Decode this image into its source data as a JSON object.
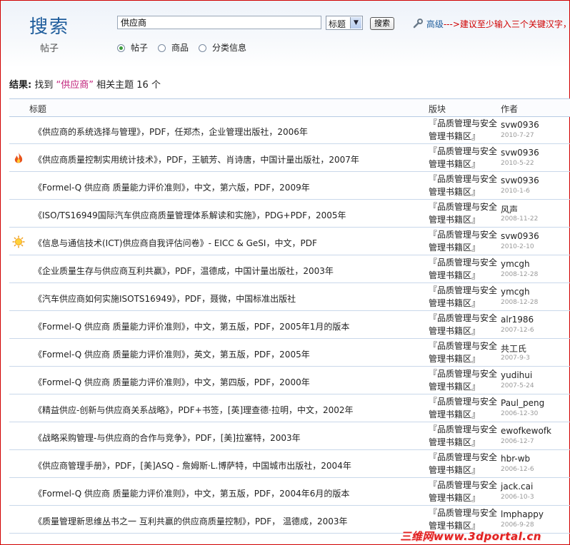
{
  "header": {
    "brand": "搜索",
    "brand_sub": "帖子",
    "search_value": "供应商",
    "select_value": "标题",
    "search_button": "搜索",
    "advanced_link": "高级",
    "advanced_hint": "--->建议至少输入三个关键汉字，",
    "radios": [
      {
        "label": "帖子",
        "checked": true
      },
      {
        "label": "商品",
        "checked": false
      },
      {
        "label": "分类信息",
        "checked": false
      }
    ]
  },
  "results": {
    "label": "结果:",
    "found": "找到",
    "keyword": "“供应商”",
    "related": "相关主题",
    "count": "16 个"
  },
  "table": {
    "columns": {
      "title": "标题",
      "forum": "版块",
      "author": "作者"
    },
    "rows": [
      {
        "icon": "",
        "title": "《供应商的系统选择与管理》，PDF，任郑杰，企业管理出版社，2006年",
        "forum": "『品质管理与安全管理书籍区』",
        "author": "svw0936",
        "date": "2010-7-27"
      },
      {
        "icon": "fire-icon",
        "title": "《供应商质量控制实用统计技术》，PDF，王毓芳、肖诗唐，中国计量出版社，2007年",
        "forum": "『品质管理与安全管理书籍区』",
        "author": "svw0936",
        "date": "2010-5-22"
      },
      {
        "icon": "",
        "title": "《Formel-Q 供应商 质量能力评价准则》，中文，第六版，PDF，2009年",
        "forum": "『品质管理与安全管理书籍区』",
        "author": "svw0936",
        "date": "2010-1-6"
      },
      {
        "icon": "",
        "title": "《ISO/TS16949国际汽车供应商质量管理体系解读和实施》，PDG+PDF，2005年",
        "forum": "『品质管理与安全管理书籍区』",
        "author": "风声",
        "date": "2008-11-22"
      },
      {
        "icon": "sun-icon",
        "title": "《信息与通信技术(ICT)供应商自我评估问卷》- EICC & GeSI，中文，PDF",
        "forum": "『品质管理与安全管理书籍区』",
        "author": "svw0936",
        "date": "2010-2-10"
      },
      {
        "icon": "",
        "title": "《企业质量生存与供应商互利共赢》，PDF，温德成，中国计量出版社，2003年",
        "forum": "『品质管理与安全管理书籍区』",
        "author": "ymcgh",
        "date": "2008-12-28"
      },
      {
        "icon": "",
        "title": "《汽车供应商如何实施ISOTS16949》，PDF，聂微，中国标准出版社",
        "forum": "『品质管理与安全管理书籍区』",
        "author": "ymcgh",
        "date": "2008-12-28"
      },
      {
        "icon": "",
        "title": "《Formel-Q 供应商 质量能力评价准则》，中文，第五版，PDF，2005年1月的版本",
        "forum": "『品质管理与安全管理书籍区』",
        "author": "alr1986",
        "date": "2007-12-6"
      },
      {
        "icon": "",
        "title": "《Formel-Q 供应商 质量能力评价准则》，英文，第五版，PDF，2005年",
        "forum": "『品质管理与安全管理书籍区』",
        "author": "共工氏",
        "date": "2007-9-3"
      },
      {
        "icon": "",
        "title": "《Formel-Q 供应商 质量能力评价准则》，中文，第四版，PDF，2000年",
        "forum": "『品质管理与安全管理书籍区』",
        "author": "yudihui",
        "date": "2007-5-24"
      },
      {
        "icon": "",
        "title": "《精益供应-创新与供应商关系战略》，PDF+书签，[英]理查德·拉明，中文，2002年",
        "forum": "『品质管理与安全管理书籍区』",
        "author": "Paul_peng",
        "date": "2006-12-30"
      },
      {
        "icon": "",
        "title": "《战略采购管理-与供应商的合作与竞争》，PDF，[美]拉塞特，2003年",
        "forum": "『品质管理与安全管理书籍区』",
        "author": "ewofkewofk",
        "date": "2006-12-7"
      },
      {
        "icon": "",
        "title": "《供应商管理手册》，PDF，[美]ASQ - 詹姆斯·L.博萨特，中国城市出版社，2004年",
        "forum": "『品质管理与安全管理书籍区』",
        "author": "hbr-wb",
        "date": "2006-12-6"
      },
      {
        "icon": "",
        "title": "《Formel-Q 供应商 质量能力评价准则》，中文，第五版，PDF，2004年6月的版本",
        "forum": "『品质管理与安全管理书籍区』",
        "author": "jack.cai",
        "date": "2006-10-3"
      },
      {
        "icon": "",
        "title": "《质量管理新思维丛书之一 互利共赢的供应商质量控制》，PDF， 温德成，2003年",
        "forum": "『品质管理与安全管理书籍区』",
        "author": "lmphappy",
        "date": "2006-9-28"
      }
    ]
  },
  "watermark": "三维网www.3dportal.cn"
}
